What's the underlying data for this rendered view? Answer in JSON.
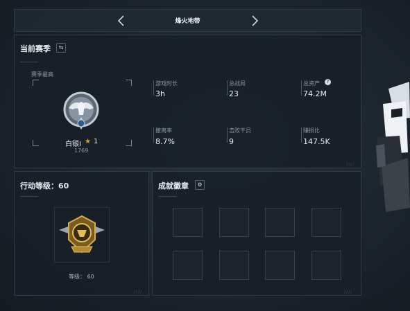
{
  "header": {
    "title": "烽火地带",
    "prev_icon": "chevron-left-icon",
    "next_icon": "chevron-right-icon"
  },
  "season": {
    "title": "当前赛季",
    "switch_icon": "swap-icon",
    "best_label": "赛季最高",
    "rank_name": "白银I",
    "rank_stars": "1",
    "rank_score": "1769",
    "stats": [
      {
        "label": "游戏时长",
        "value": "3h"
      },
      {
        "label": "总战局",
        "value": "23"
      },
      {
        "label": "总资产",
        "value": "74.2M"
      },
      {
        "label": "撤离率",
        "value": "8.7%"
      },
      {
        "label": "击败干员",
        "value": "9"
      },
      {
        "label": "赚损比",
        "value": "147.5K"
      }
    ]
  },
  "action_level": {
    "title": "行动等级：60",
    "level_label": "等级： 60"
  },
  "achievements": {
    "title": "成就徽章",
    "settings_icon": "gear-icon",
    "slots": 8
  },
  "colors": {
    "gold": "#c9a03f",
    "silver": "#b9c3cc",
    "panel": "#181f27"
  }
}
